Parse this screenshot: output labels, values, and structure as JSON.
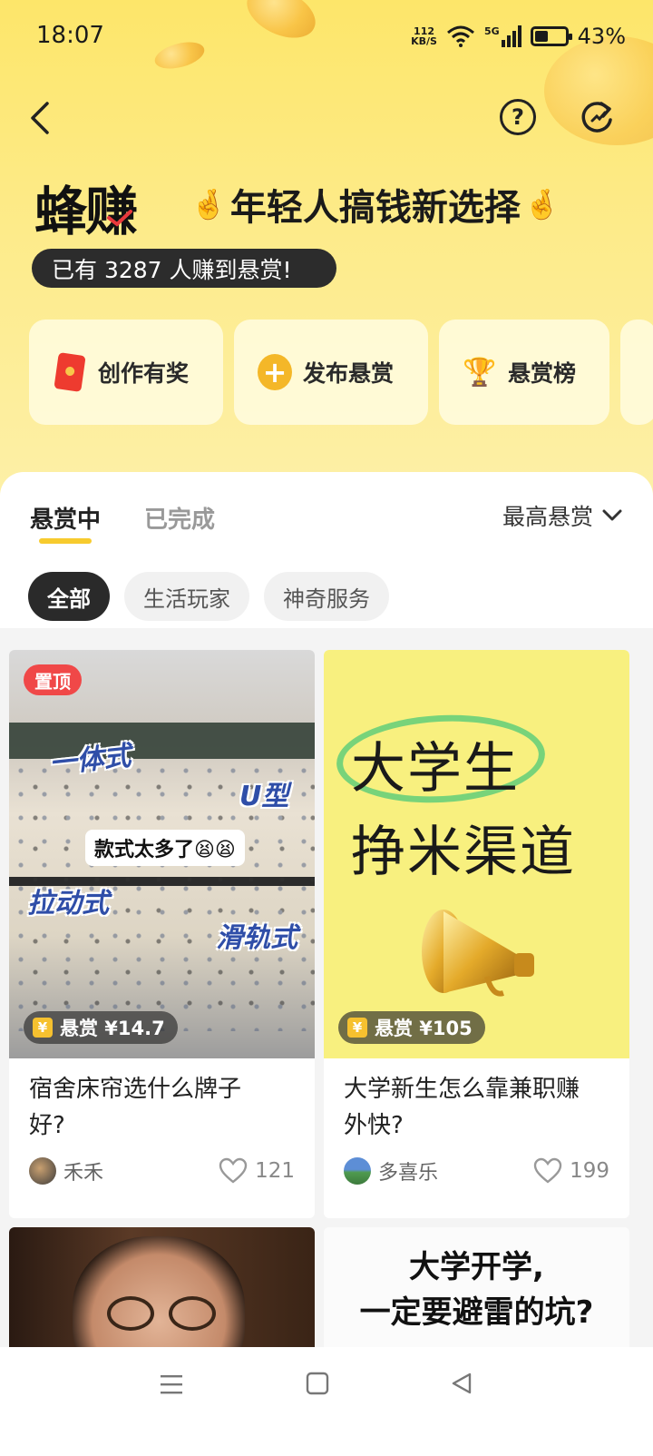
{
  "status_bar": {
    "time": "18:07",
    "net_speed_value": "112",
    "net_speed_unit": "KB/S",
    "signal_type": "5G",
    "battery": "43%",
    "battery_level": 0.43
  },
  "header": {
    "brand": "蜂赚",
    "slogan": "年轻人搞钱新选择",
    "earned_text": "已有 3287 人赚到悬赏!"
  },
  "quick_actions": [
    {
      "label": "创作有奖",
      "icon": "red-packet-icon"
    },
    {
      "label": "发布悬赏",
      "icon": "plus-bubble-icon"
    },
    {
      "label": "悬赏榜",
      "icon": "trophy-icon"
    }
  ],
  "tabs": [
    {
      "label": "悬赏中",
      "active": true
    },
    {
      "label": "已完成",
      "active": false
    }
  ],
  "sort": {
    "label": "最高悬赏"
  },
  "filters": [
    {
      "label": "全部",
      "active": true
    },
    {
      "label": "生活玩家",
      "active": false
    },
    {
      "label": "神奇服务",
      "active": false
    }
  ],
  "cards": [
    {
      "pin": "置顶",
      "reward": "悬赏 ¥14.7",
      "title_line1": "宿舍床帘选什么牌子",
      "title_line2": "好?",
      "author": "禾禾",
      "likes": "121",
      "image_texts": [
        "一体式",
        "U型",
        "款式太多了😫😫",
        "拉动式",
        "滑轨式"
      ]
    },
    {
      "reward": "悬赏 ¥105",
      "title_line1": "大学新生怎么靠兼职赚",
      "title_line2": "外快?",
      "author": "多喜乐",
      "likes": "199",
      "image_texts": [
        "大学生",
        "挣米渠道"
      ]
    },
    {
      "image_texts": []
    },
    {
      "image_texts": [
        "大学开学,",
        "一定要避雷的坑?"
      ]
    }
  ],
  "colors": {
    "accent_yellow": "#f7cb2e",
    "header_bg": "#fde66a",
    "pin_red": "#f04848"
  }
}
